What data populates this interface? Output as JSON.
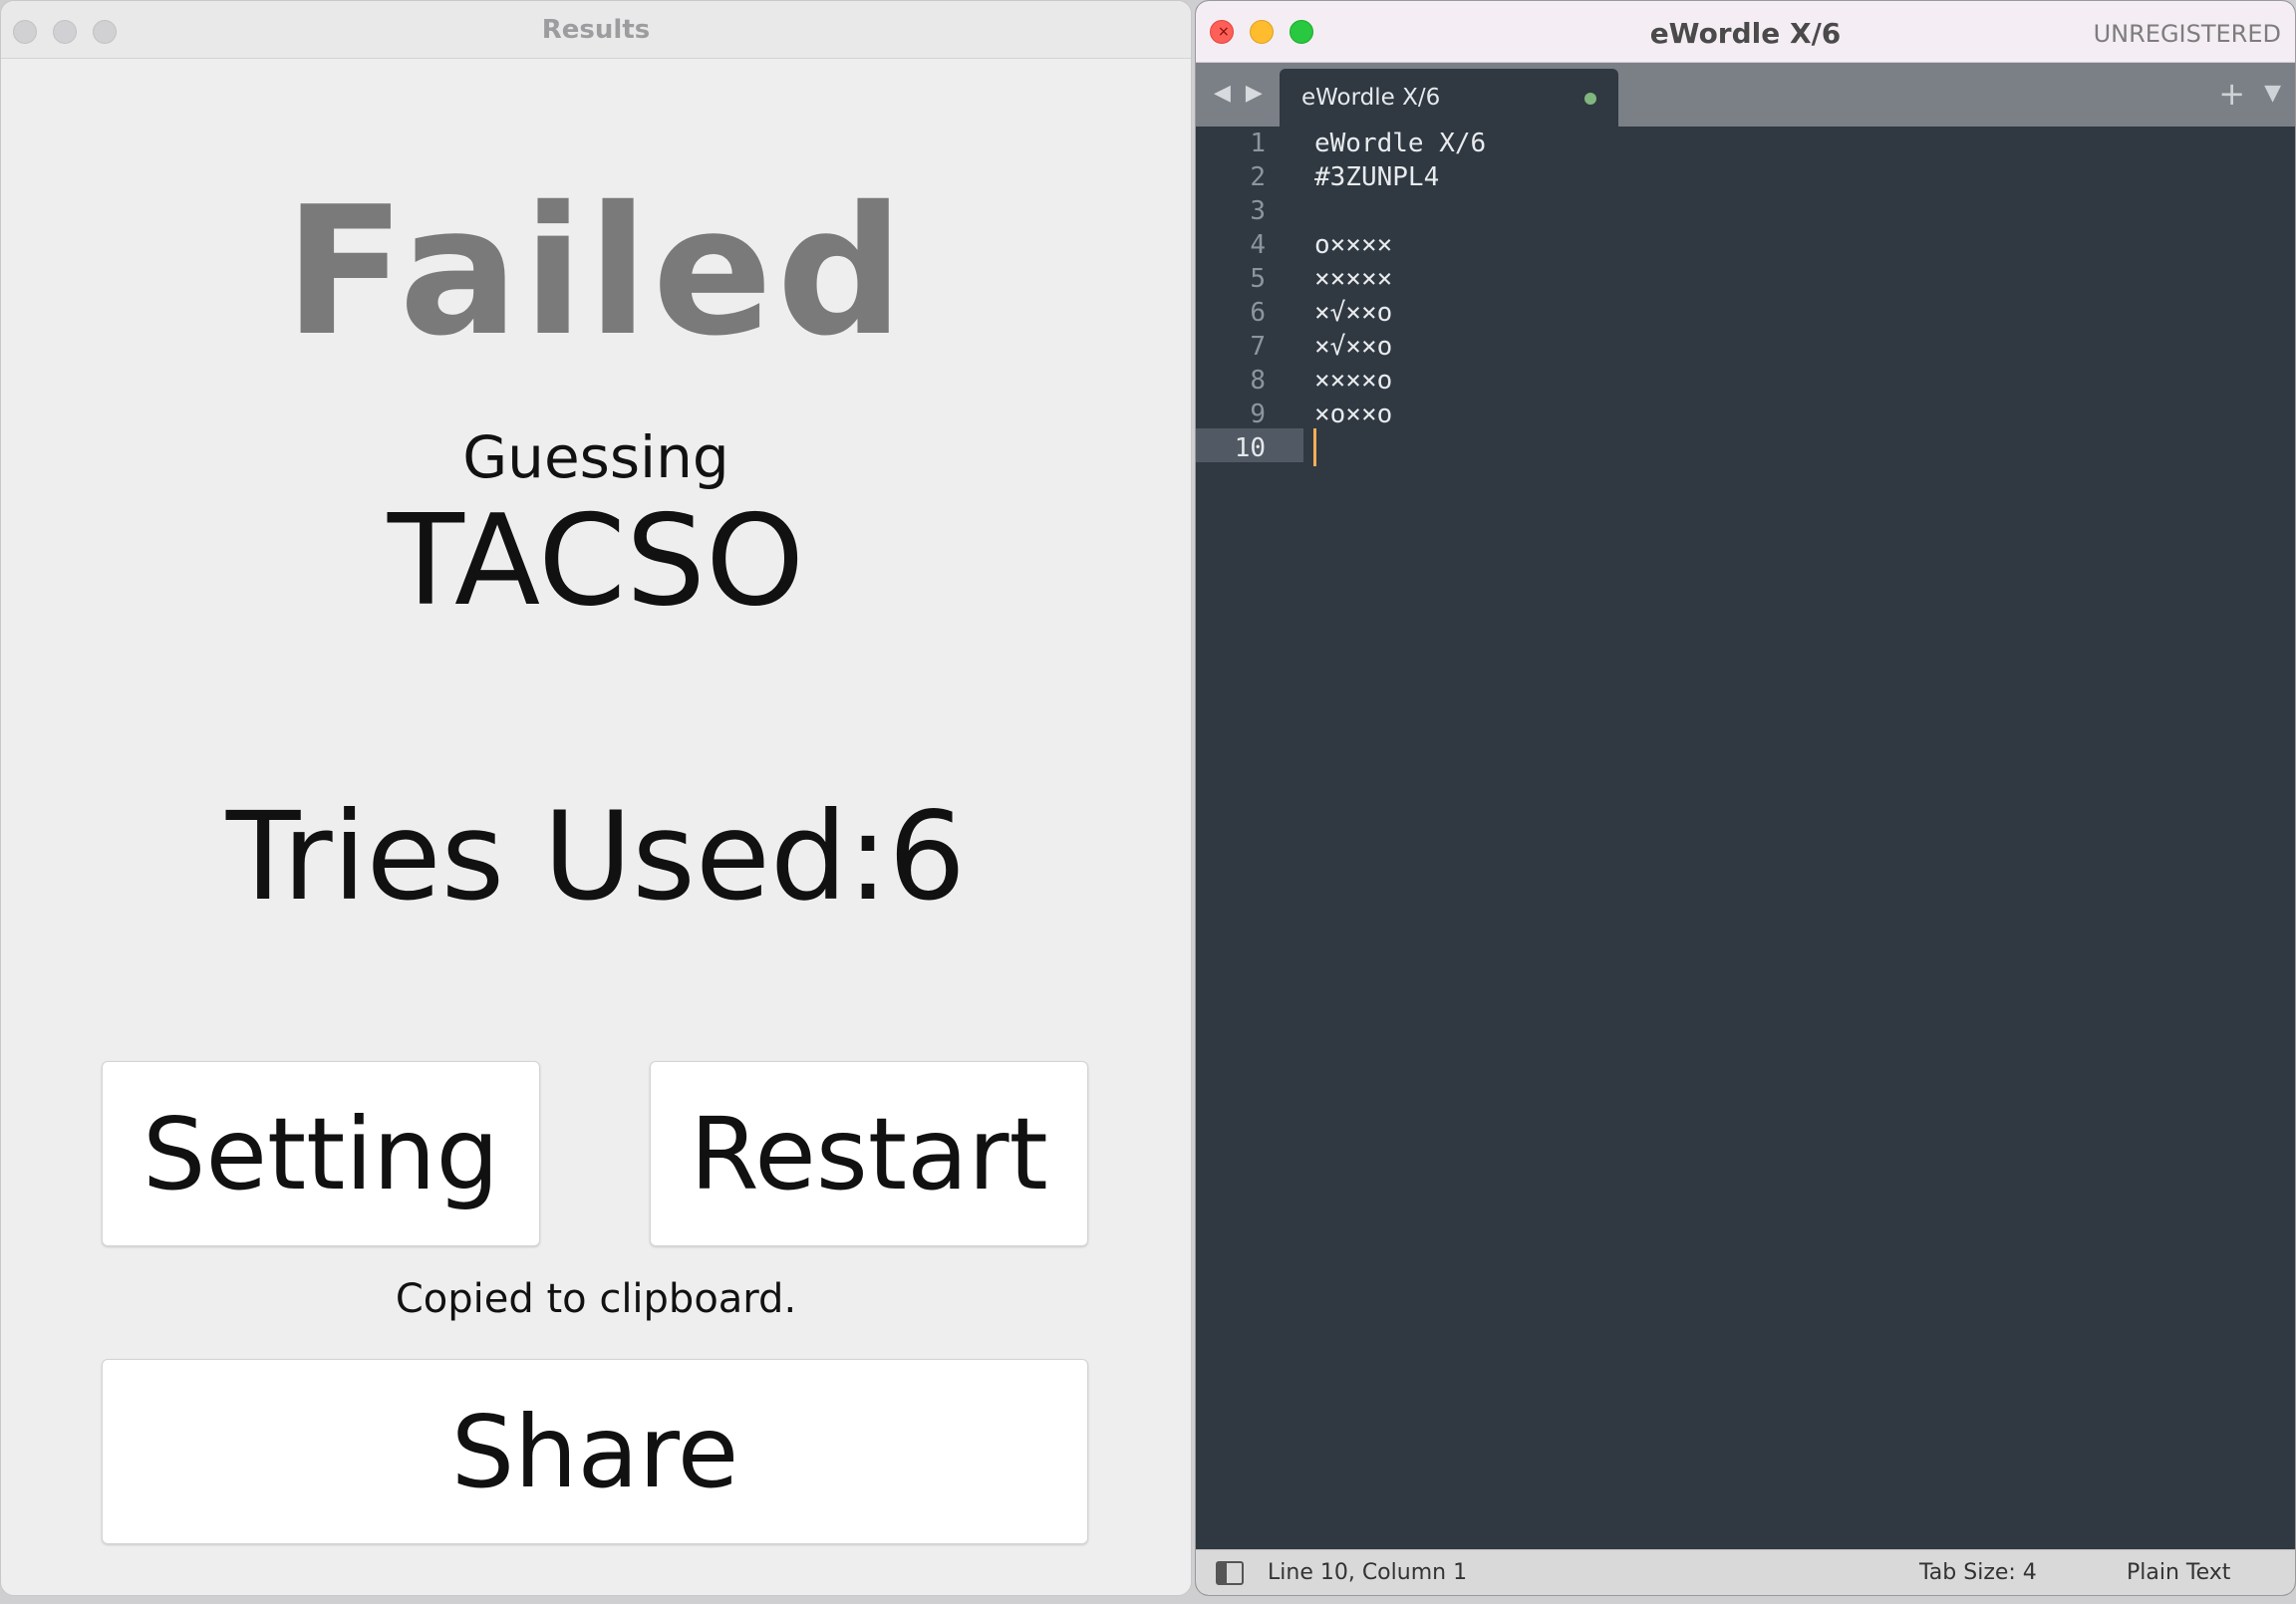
{
  "results_window": {
    "title": "Results",
    "heading": "Failed",
    "guessing_label": "Guessing",
    "guess_word": "TACSO",
    "tries_label": "Tries Used:6",
    "setting_button": "Setting",
    "restart_button": "Restart",
    "copied_message": "Copied to clipboard.",
    "share_button": "Share"
  },
  "editor_window": {
    "title": "eWordle X/6",
    "registration": "UNREGISTERED",
    "tab": {
      "label": "eWordle X/6",
      "modified": true
    },
    "nav_arrows": "◀ ▶",
    "plus_icon": "+",
    "menu_icon": "▼",
    "lines": [
      {
        "num": "1",
        "text": "eWordle X/6"
      },
      {
        "num": "2",
        "text": "#3ZUNPL4"
      },
      {
        "num": "3",
        "text": ""
      },
      {
        "num": "4",
        "text": "o××××"
      },
      {
        "num": "5",
        "text": "×××××"
      },
      {
        "num": "6",
        "text": "×√××o"
      },
      {
        "num": "7",
        "text": "×√××o"
      },
      {
        "num": "8",
        "text": "××××o"
      },
      {
        "num": "9",
        "text": "×o××o"
      },
      {
        "num": "10",
        "text": ""
      }
    ],
    "current_line": 10,
    "status": {
      "position": "Line 10, Column 1",
      "tab_size": "Tab Size: 4",
      "syntax": "Plain Text"
    }
  },
  "colors": {
    "editor_bg": "#303841",
    "cursor": "#f9ae58",
    "modified_dot": "#7fb77e",
    "failed_text": "#7a7a7b"
  }
}
